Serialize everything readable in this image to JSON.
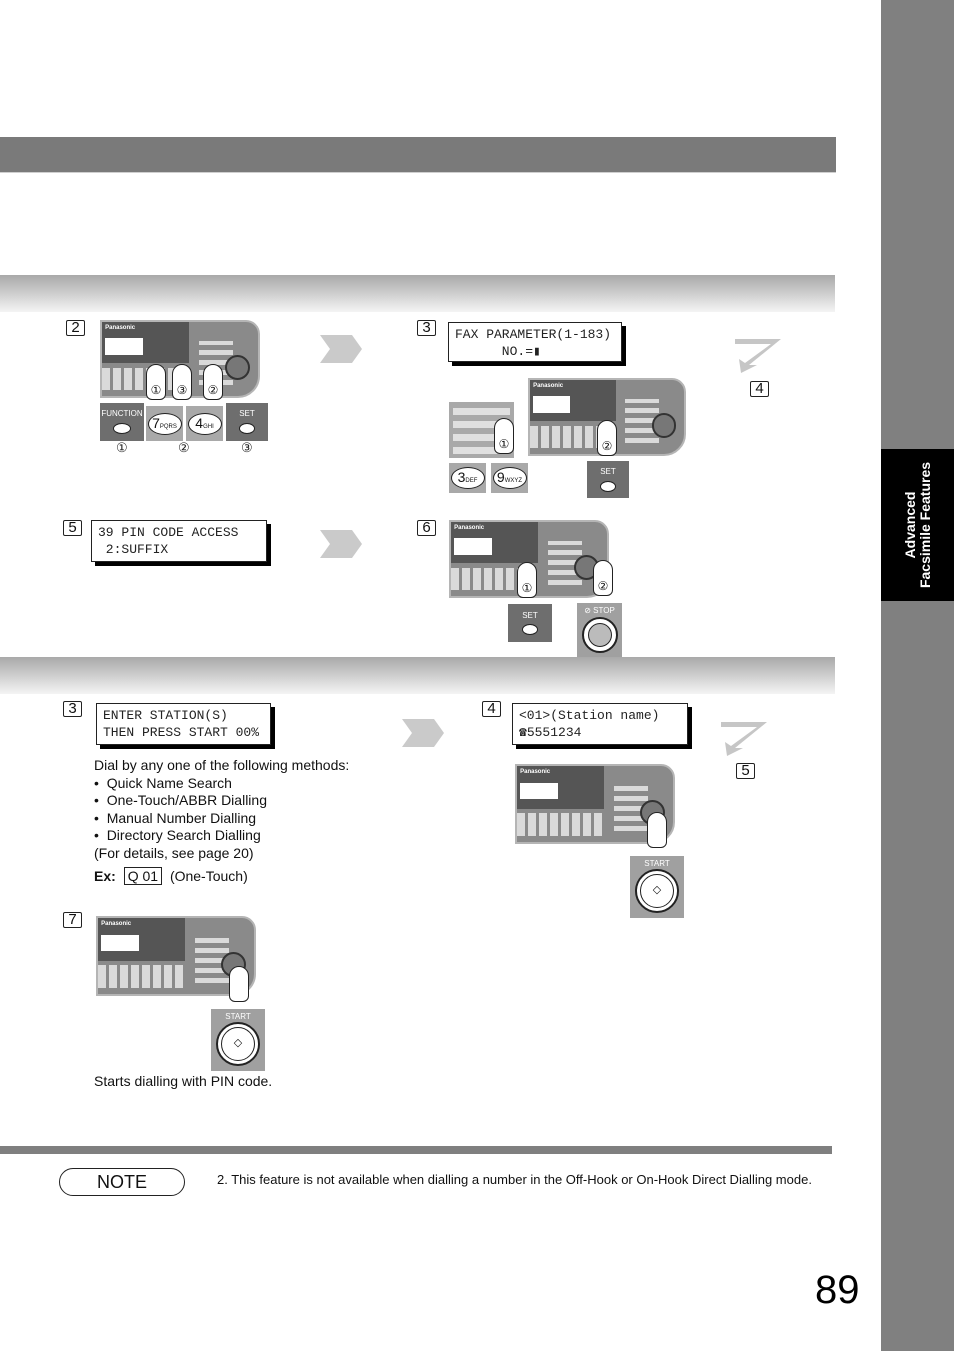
{
  "side_tab": {
    "line1": "Advanced",
    "line2": "Facsimile Features"
  },
  "section_a": {
    "steps": [
      {
        "number": "2",
        "keys": [
          "FUNCTION",
          "7",
          "4",
          "SET"
        ],
        "key_subs": [
          "",
          "PQRS",
          "GHI",
          ""
        ],
        "markers": [
          "①",
          "②",
          "③"
        ]
      },
      {
        "number": "3",
        "lcd_line1": "FAX PARAMETER(1-183)",
        "lcd_line2": "      NO.=▮",
        "keys": [
          "3",
          "9",
          "SET"
        ],
        "key_subs": [
          "DEF",
          "WXYZ",
          ""
        ],
        "markers": [
          "①",
          "②"
        ]
      },
      {
        "number": "4"
      },
      {
        "number": "5",
        "lcd_line1": "39 PIN CODE ACCESS",
        "lcd_line2": " 2:SUFFIX"
      },
      {
        "number": "6",
        "keys": [
          "SET",
          "STOP"
        ],
        "markers": [
          "①",
          "②"
        ]
      }
    ]
  },
  "section_b": {
    "steps": [
      {
        "number": "3",
        "lcd_line1": "ENTER STATION(S)",
        "lcd_line2": "THEN PRESS START 00%",
        "intro": "Dial by any one of the following methods:",
        "methods": [
          "Quick Name Search",
          "One-Touch/ABBR Dialling",
          "Manual Number Dialling",
          "Directory Search Dialling"
        ],
        "details": "(For details, see page 20)",
        "ex_label": "Ex:",
        "ex_key": "Q 01",
        "ex_note": "(One-Touch)"
      },
      {
        "number": "4",
        "lcd_line1": "<01>(Station name)",
        "lcd_line2": "☎5551234",
        "key": "START"
      },
      {
        "number": "5"
      },
      {
        "number": "7",
        "key": "START",
        "caption": "Starts dialling with PIN code."
      }
    ]
  },
  "panel_brand": "Panasonic",
  "note": {
    "label": "NOTE",
    "text": "2.  This feature is not available when dialling a number in the Off-Hook or On-Hook Direct Dialling mode."
  },
  "page_number": "89"
}
